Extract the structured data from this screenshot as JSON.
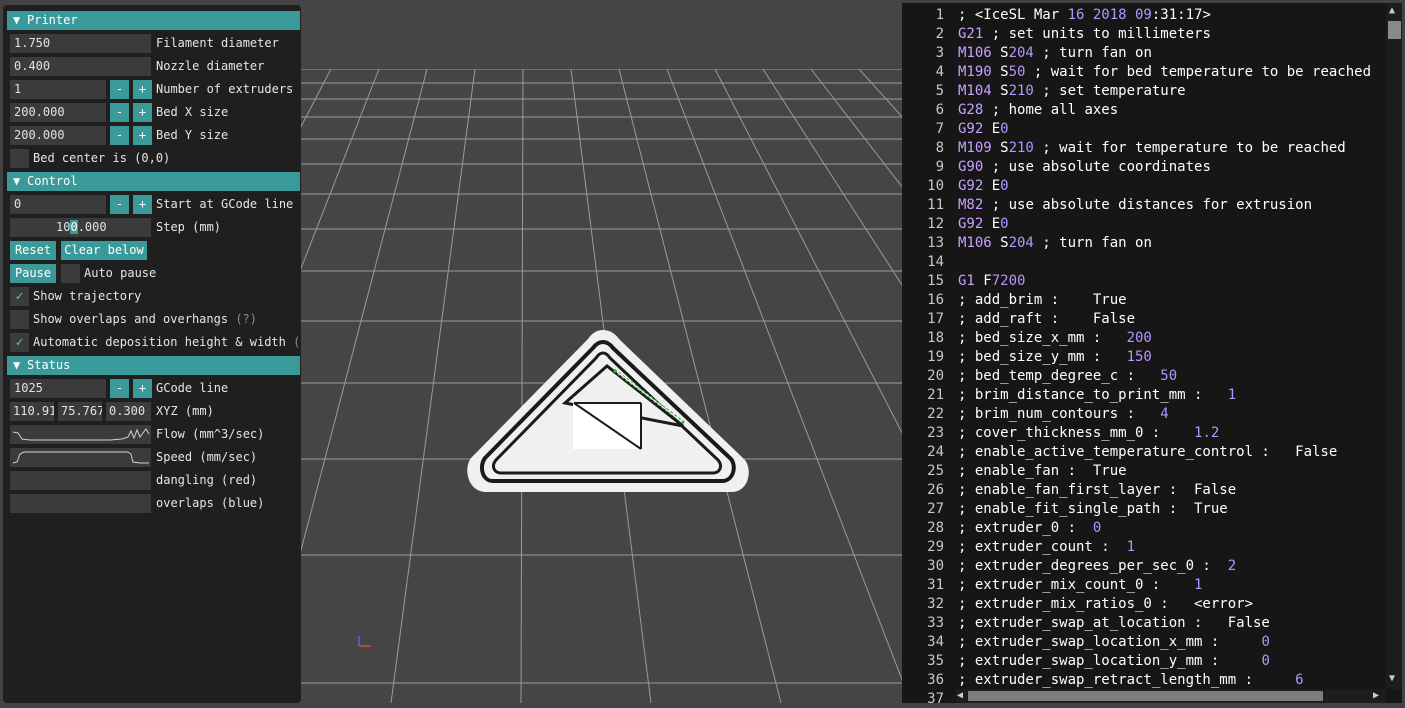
{
  "printer": {
    "header": "Printer",
    "filament_value": "1.750",
    "filament_label": "Filament diameter",
    "nozzle_value": "0.400",
    "nozzle_label": "Nozzle diameter",
    "extruders_value": "1",
    "extruders_label": "Number of extruders",
    "bedx_value": "200.000",
    "bedx_label": "Bed X size",
    "bedy_value": "200.000",
    "bedy_label": "Bed Y size",
    "bedcenter_label": "Bed center is (0,0)",
    "minus": "-",
    "plus": "+"
  },
  "control": {
    "header": "Control",
    "start_value": "0",
    "start_label": "Start at GCode line",
    "step_value_a": "10",
    "step_value_b": "0",
    "step_value_c": ".000",
    "step_label": "Step (mm)",
    "reset": "Reset",
    "clear_below": "Clear below",
    "pause": "Pause",
    "auto_pause": "Auto pause",
    "show_trajectory": "Show trajectory",
    "show_overlaps": "Show overlaps and overhangs",
    "overlaps_hint": "(?)",
    "auto_deposition": "Automatic deposition height & width",
    "auto_deposition_hint": "(?"
  },
  "status": {
    "header": "Status",
    "gcode_value": "1025",
    "gcode_label": "GCode line",
    "x": "110.91",
    "y": "75.767",
    "z": "0.300",
    "xyz_label": "XYZ (mm)",
    "flow_label": "Flow (mm^3/sec)",
    "speed_label": "Speed (mm/sec)",
    "dangling_label": "dangling (red)",
    "overlaps_label": "overlaps (blue)"
  },
  "checkmark": "✓",
  "triangle": "▼",
  "editor": {
    "line_numbers": [
      "1",
      "2",
      "3",
      "4",
      "5",
      "6",
      "7",
      "8",
      "9",
      "10",
      "11",
      "12",
      "13",
      "14",
      "15",
      "16",
      "17",
      "18",
      "19",
      "20",
      "21",
      "22",
      "23",
      "24",
      "25",
      "26",
      "27",
      "28",
      "29",
      "30",
      "31",
      "32",
      "33",
      "34",
      "35",
      "36",
      "37"
    ],
    "lines": [
      "; <IceSL Mar 16 2018 09:31:17>",
      "G21 ; set units to millimeters",
      "M106 S204 ; turn fan on",
      "M190 S50 ; wait for bed temperature to be reached",
      "M104 S210 ; set temperature",
      "G28 ; home all axes",
      "G92 E0",
      "M109 S210 ; wait for temperature to be reached",
      "G90 ; use absolute coordinates",
      "G92 E0",
      "M82 ; use absolute distances for extrusion",
      "G92 E0",
      "M106 S204 ; turn fan on",
      "",
      "G1 F7200",
      "; add_brim :    True",
      "; add_raft :    False",
      "; bed_size_x_mm :   200",
      "; bed_size_y_mm :   150",
      "; bed_temp_degree_c :   50",
      "; brim_distance_to_print_mm :   1",
      "; brim_num_contours :   4",
      "; cover_thickness_mm_0 :    1.2",
      "; enable_active_temperature_control :   False",
      "; enable_fan :  True",
      "; enable_fan_first_layer :  False",
      "; enable_fit_single_path :  True",
      "; extruder_0 :  0",
      "; extruder_count :  1",
      "; extruder_degrees_per_sec_0 :  2",
      "; extruder_mix_count_0 :    1",
      "; extruder_mix_ratios_0 :   <error>",
      "; extruder_swap_at_location :   False",
      "; extruder_swap_location_x_mm :     0",
      "; extruder_swap_location_y_mm :     0",
      "; extruder_swap_retract_length_mm :     6",
      ""
    ]
  },
  "colors": {
    "accent": "#3a9a9a",
    "keyword": "#c8a1ff",
    "number": "#b595ff"
  }
}
